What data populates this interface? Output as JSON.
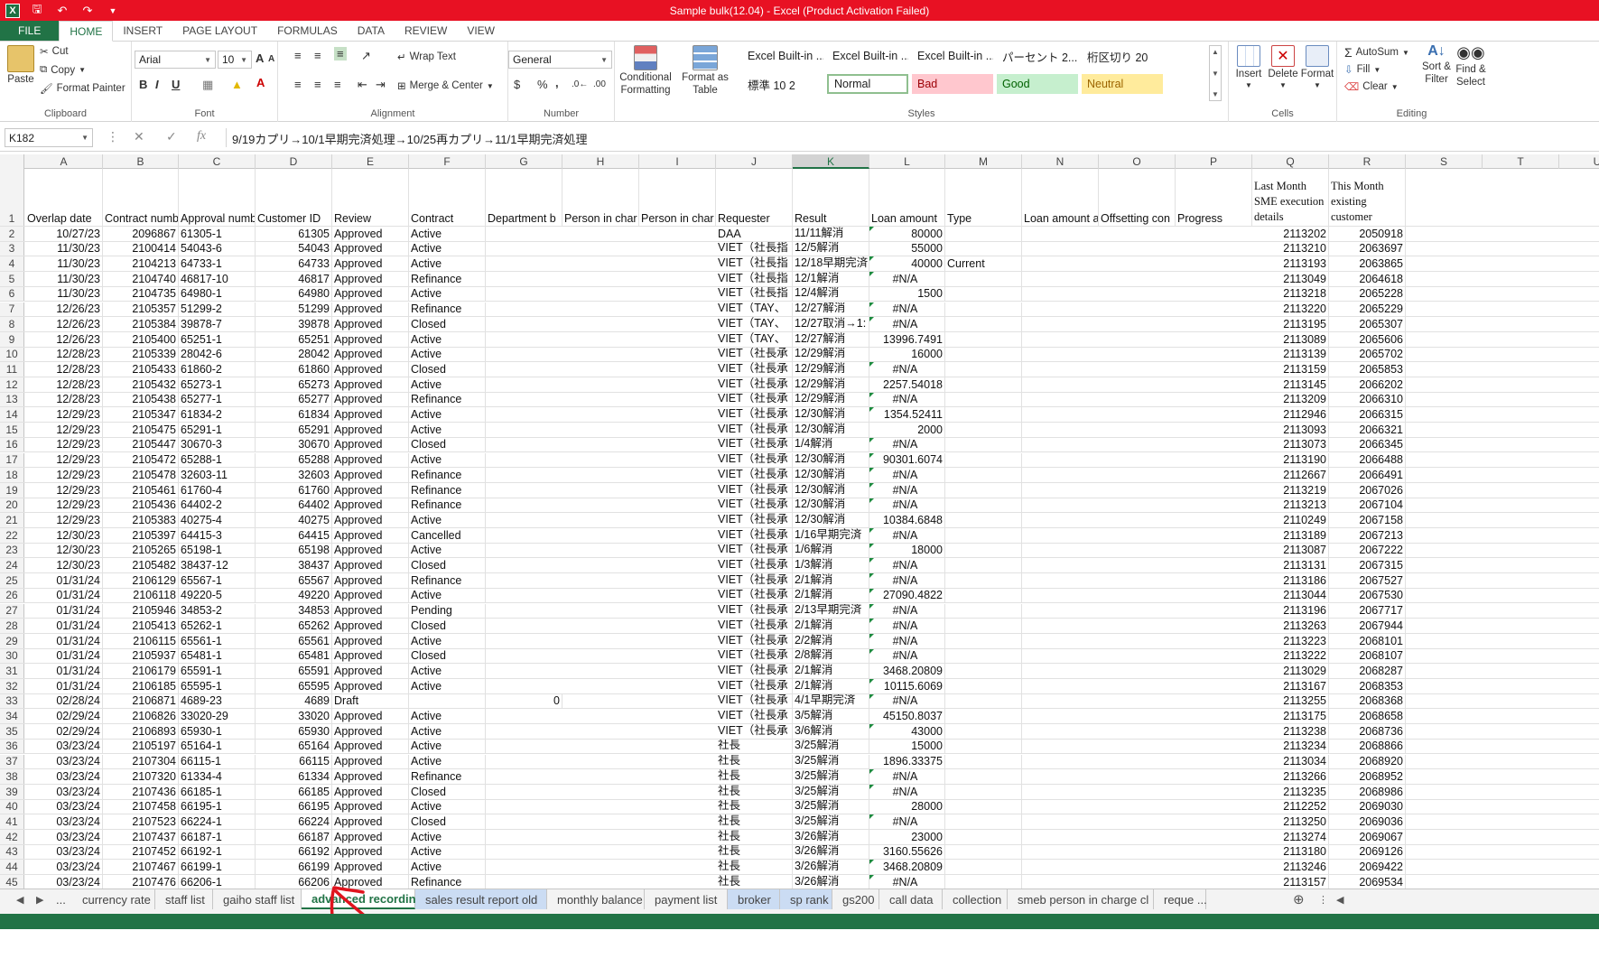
{
  "app": {
    "title": "Sample bulk(12.04) -  Excel (Product Activation Failed)",
    "logo_letter": "X"
  },
  "ribbon_tabs": [
    "FILE",
    "HOME",
    "INSERT",
    "PAGE LAYOUT",
    "FORMULAS",
    "DATA",
    "REVIEW",
    "VIEW"
  ],
  "active_ribbon_tab": "HOME",
  "clipboard": {
    "paste": "Paste",
    "cut": "Cut",
    "copy": "Copy",
    "format_painter": "Format Painter",
    "label": "Clipboard"
  },
  "font": {
    "name": "Arial",
    "size": "10",
    "bold": "B",
    "italic": "I",
    "underline": "U",
    "label": "Font",
    "grow": "A",
    "shrink": "A"
  },
  "alignment": {
    "wrap_text": "Wrap Text",
    "merge_center": "Merge & Center",
    "label": "Alignment"
  },
  "number": {
    "format": "General",
    "currency": "$",
    "percent": "%",
    "comma": ",",
    "label": "Number"
  },
  "styles": {
    "conditional_formatting": "Conditional Formatting",
    "format_as_table": "Format as Table",
    "gallery_top": [
      "Excel Built-in ...",
      "Excel Built-in ...",
      "Excel Built-in ...",
      "パーセント 2...",
      "桁区切り 20"
    ],
    "gallery_bottom": [
      "標準 10 2",
      "Normal",
      "Bad",
      "Good",
      "Neutral"
    ],
    "label": "Styles"
  },
  "cells_group": {
    "insert": "Insert",
    "delete": "Delete",
    "format": "Format",
    "label": "Cells"
  },
  "editing": {
    "autosum": "AutoSum",
    "fill": "Fill",
    "clear": "Clear",
    "sort_filter": "Sort & Filter",
    "find_select": "Find & Select",
    "label": "Editing"
  },
  "formula_bar": {
    "name_box": "K182",
    "fx": "fx",
    "formula": "9/19カプリ→10/1早期完済処理→10/25再カプリ→11/1早期完済処理"
  },
  "columns": [
    "A",
    "B",
    "C",
    "D",
    "E",
    "F",
    "G",
    "H",
    "I",
    "J",
    "K",
    "L",
    "M",
    "N",
    "O",
    "P",
    "Q",
    "R",
    "S",
    "T",
    "U"
  ],
  "selected_column": "K",
  "header_row": {
    "A": "Overlap date",
    "B": "Contract numb",
    "C": "Approval numb",
    "D": "Customer ID",
    "E": "Review",
    "F": "Contract",
    "G": "Department b",
    "H": "Person in char",
    "I": "Person in char",
    "J": "Requester",
    "K": "Result",
    "L": "Loan amount",
    "M": "Type",
    "N": "Loan amount a",
    "O": "Offsetting con",
    "P": "Progress",
    "Q": "Last Month SME execution details",
    "R": "This Month existing customer"
  },
  "rows": [
    {
      "n": "2",
      "A": "10/27/23",
      "B": "2096867",
      "C": "61305-1",
      "D": "61305",
      "E": "Approved",
      "F": "Active",
      "J": "DAA",
      "K": "11/11解消",
      "L": "80000",
      "M": "",
      "Q": "2113202",
      "R": "2050918"
    },
    {
      "n": "3",
      "A": "11/30/23",
      "B": "2100414",
      "C": "54043-6",
      "D": "54043",
      "E": "Approved",
      "F": "Active",
      "J": "VIET（社長指",
      "K": "12/5解消",
      "L": "55000",
      "M": "",
      "Q": "2113210",
      "R": "2063697"
    },
    {
      "n": "4",
      "A": "11/30/23",
      "B": "2104213",
      "C": "64733-1",
      "D": "64733",
      "E": "Approved",
      "F": "Active",
      "J": "VIET（社長指",
      "K": "12/18早期完済",
      "L": "40000",
      "M": "Current",
      "Q": "2113193",
      "R": "2063865"
    },
    {
      "n": "5",
      "A": "11/30/23",
      "B": "2104740",
      "C": "46817-10",
      "D": "46817",
      "E": "Approved",
      "F": "Refinance",
      "J": "VIET（社長指",
      "K": "12/1解消",
      "L": "#N/A",
      "M": "",
      "Q": "2113049",
      "R": "2064618"
    },
    {
      "n": "6",
      "A": "11/30/23",
      "B": "2104735",
      "C": "64980-1",
      "D": "64980",
      "E": "Approved",
      "F": "Active",
      "J": "VIET（社長指",
      "K": "12/4解消",
      "L": "1500",
      "M": "",
      "Q": "2113218",
      "R": "2065228"
    },
    {
      "n": "7",
      "A": "12/26/23",
      "B": "2105357",
      "C": "51299-2",
      "D": "51299",
      "E": "Approved",
      "F": "Refinance",
      "J": "VIET（TAY、",
      "K": "12/27解消",
      "L": "#N/A",
      "M": "",
      "Q": "2113220",
      "R": "2065229"
    },
    {
      "n": "8",
      "A": "12/26/23",
      "B": "2105384",
      "C": "39878-7",
      "D": "39878",
      "E": "Approved",
      "F": "Closed",
      "J": "VIET（TAY、",
      "K": "12/27取消→1:",
      "L": "#N/A",
      "M": "",
      "Q": "2113195",
      "R": "2065307"
    },
    {
      "n": "9",
      "A": "12/26/23",
      "B": "2105400",
      "C": "65251-1",
      "D": "65251",
      "E": "Approved",
      "F": "Active",
      "J": "VIET（TAY、",
      "K": "12/27解消",
      "L": "13996.7491",
      "M": "",
      "Q": "2113089",
      "R": "2065606"
    },
    {
      "n": "10",
      "A": "12/28/23",
      "B": "2105339",
      "C": "28042-6",
      "D": "28042",
      "E": "Approved",
      "F": "Active",
      "J": "VIET（社長承",
      "K": "12/29解消",
      "L": "16000",
      "M": "",
      "Q": "2113139",
      "R": "2065702"
    },
    {
      "n": "11",
      "A": "12/28/23",
      "B": "2105433",
      "C": "61860-2",
      "D": "61860",
      "E": "Approved",
      "F": "Closed",
      "J": "VIET（社長承",
      "K": "12/29解消",
      "L": "#N/A",
      "M": "",
      "Q": "2113159",
      "R": "2065853"
    },
    {
      "n": "12",
      "A": "12/28/23",
      "B": "2105432",
      "C": "65273-1",
      "D": "65273",
      "E": "Approved",
      "F": "Active",
      "J": "VIET（社長承",
      "K": "12/29解消",
      "L": "2257.54018",
      "M": "",
      "Q": "2113145",
      "R": "2066202"
    },
    {
      "n": "13",
      "A": "12/28/23",
      "B": "2105438",
      "C": "65277-1",
      "D": "65277",
      "E": "Approved",
      "F": "Refinance",
      "J": "VIET（社長承",
      "K": "12/29解消",
      "L": "#N/A",
      "M": "",
      "Q": "2113209",
      "R": "2066310"
    },
    {
      "n": "14",
      "A": "12/29/23",
      "B": "2105347",
      "C": "61834-2",
      "D": "61834",
      "E": "Approved",
      "F": "Active",
      "J": "VIET（社長承",
      "K": "12/30解消",
      "L": "1354.52411",
      "M": "",
      "Q": "2112946",
      "R": "2066315"
    },
    {
      "n": "15",
      "A": "12/29/23",
      "B": "2105475",
      "C": "65291-1",
      "D": "65291",
      "E": "Approved",
      "F": "Active",
      "J": "VIET（社長承",
      "K": "12/30解消",
      "L": "2000",
      "M": "",
      "Q": "2113093",
      "R": "2066321"
    },
    {
      "n": "16",
      "A": "12/29/23",
      "B": "2105447",
      "C": "30670-3",
      "D": "30670",
      "E": "Approved",
      "F": "Closed",
      "J": "VIET（社長承",
      "K": "1/4解消",
      "L": "#N/A",
      "M": "",
      "Q": "2113073",
      "R": "2066345"
    },
    {
      "n": "17",
      "A": "12/29/23",
      "B": "2105472",
      "C": "65288-1",
      "D": "65288",
      "E": "Approved",
      "F": "Active",
      "J": "VIET（社長承",
      "K": "12/30解消",
      "L": "90301.6074",
      "M": "",
      "Q": "2113190",
      "R": "2066488"
    },
    {
      "n": "18",
      "A": "12/29/23",
      "B": "2105478",
      "C": "32603-11",
      "D": "32603",
      "E": "Approved",
      "F": "Refinance",
      "J": "VIET（社長承",
      "K": "12/30解消",
      "L": "#N/A",
      "M": "",
      "Q": "2112667",
      "R": "2066491"
    },
    {
      "n": "19",
      "A": "12/29/23",
      "B": "2105461",
      "C": "61760-4",
      "D": "61760",
      "E": "Approved",
      "F": "Refinance",
      "J": "VIET（社長承",
      "K": "12/30解消",
      "L": "#N/A",
      "M": "",
      "Q": "2113219",
      "R": "2067026"
    },
    {
      "n": "20",
      "A": "12/29/23",
      "B": "2105436",
      "C": "64402-2",
      "D": "64402",
      "E": "Approved",
      "F": "Refinance",
      "J": "VIET（社長承",
      "K": "12/30解消",
      "L": "#N/A",
      "M": "",
      "Q": "2113213",
      "R": "2067104"
    },
    {
      "n": "21",
      "A": "12/29/23",
      "B": "2105383",
      "C": "40275-4",
      "D": "40275",
      "E": "Approved",
      "F": "Active",
      "J": "VIET（社長承",
      "K": "12/30解消",
      "L": "10384.6848",
      "M": "",
      "Q": "2110249",
      "R": "2067158"
    },
    {
      "n": "22",
      "A": "12/30/23",
      "B": "2105397",
      "C": "64415-3",
      "D": "64415",
      "E": "Approved",
      "F": "Cancelled",
      "J": "VIET（社長承",
      "K": "1/16早期完済",
      "L": "#N/A",
      "M": "",
      "Q": "2113189",
      "R": "2067213"
    },
    {
      "n": "23",
      "A": "12/30/23",
      "B": "2105265",
      "C": "65198-1",
      "D": "65198",
      "E": "Approved",
      "F": "Active",
      "J": "VIET（社長承",
      "K": "1/6解消",
      "L": "18000",
      "M": "",
      "Q": "2113087",
      "R": "2067222"
    },
    {
      "n": "24",
      "A": "12/30/23",
      "B": "2105482",
      "C": "38437-12",
      "D": "38437",
      "E": "Approved",
      "F": "Closed",
      "J": "VIET（社長承",
      "K": "1/3解消",
      "L": "#N/A",
      "M": "",
      "Q": "2113131",
      "R": "2067315"
    },
    {
      "n": "25",
      "A": "01/31/24",
      "B": "2106129",
      "C": "65567-1",
      "D": "65567",
      "E": "Approved",
      "F": "Refinance",
      "J": "VIET（社長承",
      "K": "2/1解消",
      "L": "#N/A",
      "M": "",
      "Q": "2113186",
      "R": "2067527"
    },
    {
      "n": "26",
      "A": "01/31/24",
      "B": "2106118",
      "C": "49220-5",
      "D": "49220",
      "E": "Approved",
      "F": "Active",
      "J": "VIET（社長承",
      "K": "2/1解消",
      "L": "27090.4822",
      "M": "",
      "Q": "2113044",
      "R": "2067530"
    },
    {
      "n": "27",
      "A": "01/31/24",
      "B": "2105946",
      "C": "34853-2",
      "D": "34853",
      "E": "Approved",
      "F": "Pending",
      "J": "VIET（社長承",
      "K": "2/13早期完済",
      "L": "#N/A",
      "M": "",
      "Q": "2113196",
      "R": "2067717"
    },
    {
      "n": "28",
      "A": "01/31/24",
      "B": "2105413",
      "C": "65262-1",
      "D": "65262",
      "E": "Approved",
      "F": "Closed",
      "J": "VIET（社長承",
      "K": "2/1解消",
      "L": "#N/A",
      "M": "",
      "Q": "2113263",
      "R": "2067944"
    },
    {
      "n": "29",
      "A": "01/31/24",
      "B": "2106115",
      "C": "65561-1",
      "D": "65561",
      "E": "Approved",
      "F": "Active",
      "J": "VIET（社長承",
      "K": "2/2解消",
      "L": "#N/A",
      "M": "",
      "Q": "2113223",
      "R": "2068101"
    },
    {
      "n": "30",
      "A": "01/31/24",
      "B": "2105937",
      "C": "65481-1",
      "D": "65481",
      "E": "Approved",
      "F": "Closed",
      "J": "VIET（社長承",
      "K": "2/8解消",
      "L": "#N/A",
      "M": "",
      "Q": "2113222",
      "R": "2068107"
    },
    {
      "n": "31",
      "A": "01/31/24",
      "B": "2106179",
      "C": "65591-1",
      "D": "65591",
      "E": "Approved",
      "F": "Active",
      "J": "VIET（社長承",
      "K": "2/1解消",
      "L": "3468.20809",
      "M": "",
      "Q": "2113029",
      "R": "2068287"
    },
    {
      "n": "32",
      "A": "01/31/24",
      "B": "2106185",
      "C": "65595-1",
      "D": "65595",
      "E": "Approved",
      "F": "Active",
      "J": "VIET（社長承",
      "K": "2/1解消",
      "L": "10115.6069",
      "M": "",
      "Q": "2113167",
      "R": "2068353"
    },
    {
      "n": "33",
      "A": "02/28/24",
      "B": "2106871",
      "C": "4689-23",
      "D": "4689",
      "E": "Draft",
      "F": "",
      "G": "0",
      "J": "VIET（社長承",
      "K": "4/1早期完済",
      "L": "#N/A",
      "M": "",
      "Q": "2113255",
      "R": "2068368"
    },
    {
      "n": "34",
      "A": "02/29/24",
      "B": "2106826",
      "C": "33020-29",
      "D": "33020",
      "E": "Approved",
      "F": "Active",
      "J": "VIET（社長承",
      "K": "3/5解消",
      "L": "45150.8037",
      "M": "",
      "Q": "2113175",
      "R": "2068658"
    },
    {
      "n": "35",
      "A": "02/29/24",
      "B": "2106893",
      "C": "65930-1",
      "D": "65930",
      "E": "Approved",
      "F": "Active",
      "J": "VIET（社長承",
      "K": "3/6解消",
      "L": "43000",
      "M": "",
      "Q": "2113238",
      "R": "2068736"
    },
    {
      "n": "36",
      "A": "03/23/24",
      "B": "2105197",
      "C": "65164-1",
      "D": "65164",
      "E": "Approved",
      "F": "Active",
      "J": "社長",
      "K": "3/25解消",
      "L": "15000",
      "M": "",
      "Q": "2113234",
      "R": "2068866"
    },
    {
      "n": "37",
      "A": "03/23/24",
      "B": "2107304",
      "C": "66115-1",
      "D": "66115",
      "E": "Approved",
      "F": "Active",
      "J": "社長",
      "K": "3/25解消",
      "L": "1896.33375",
      "M": "",
      "Q": "2113034",
      "R": "2068920"
    },
    {
      "n": "38",
      "A": "03/23/24",
      "B": "2107320",
      "C": "61334-4",
      "D": "61334",
      "E": "Approved",
      "F": "Refinance",
      "J": "社長",
      "K": "3/25解消",
      "L": "#N/A",
      "M": "",
      "Q": "2113266",
      "R": "2068952"
    },
    {
      "n": "39",
      "A": "03/23/24",
      "B": "2107436",
      "C": "66185-1",
      "D": "66185",
      "E": "Approved",
      "F": "Closed",
      "J": "社長",
      "K": "3/25解消",
      "L": "#N/A",
      "M": "",
      "Q": "2113235",
      "R": "2068986"
    },
    {
      "n": "40",
      "A": "03/23/24",
      "B": "2107458",
      "C": "66195-1",
      "D": "66195",
      "E": "Approved",
      "F": "Active",
      "J": "社長",
      "K": "3/25解消",
      "L": "28000",
      "M": "",
      "Q": "2112252",
      "R": "2069030"
    },
    {
      "n": "41",
      "A": "03/23/24",
      "B": "2107523",
      "C": "66224-1",
      "D": "66224",
      "E": "Approved",
      "F": "Closed",
      "J": "社長",
      "K": "3/25解消",
      "L": "#N/A",
      "M": "",
      "Q": "2113250",
      "R": "2069036"
    },
    {
      "n": "42",
      "A": "03/23/24",
      "B": "2107437",
      "C": "66187-1",
      "D": "66187",
      "E": "Approved",
      "F": "Active",
      "J": "社長",
      "K": "3/26解消",
      "L": "23000",
      "M": "",
      "Q": "2113274",
      "R": "2069067"
    },
    {
      "n": "43",
      "A": "03/23/24",
      "B": "2107452",
      "C": "66192-1",
      "D": "66192",
      "E": "Approved",
      "F": "Active",
      "J": "社長",
      "K": "3/26解消",
      "L": "3160.55626",
      "M": "",
      "Q": "2113180",
      "R": "2069126"
    },
    {
      "n": "44",
      "A": "03/23/24",
      "B": "2107467",
      "C": "66199-1",
      "D": "66199",
      "E": "Approved",
      "F": "Active",
      "J": "社長",
      "K": "3/26解消",
      "L": "3468.20809",
      "M": "",
      "Q": "2113246",
      "R": "2069422"
    },
    {
      "n": "45",
      "A": "03/23/24",
      "B": "2107476",
      "C": "66206-1",
      "D": "66206",
      "E": "Approved",
      "F": "Refinance",
      "J": "社長",
      "K": "3/26解消",
      "L": "#N/A",
      "M": "",
      "Q": "2113157",
      "R": "2069534"
    }
  ],
  "sheet_tabs": [
    {
      "name": "...",
      "style": "plain"
    },
    {
      "name": "currency rate",
      "style": "plain"
    },
    {
      "name": "staff list",
      "style": "plain"
    },
    {
      "name": "gaiho staff list",
      "style": "plain"
    },
    {
      "name": "advanced recording",
      "style": "active"
    },
    {
      "name": "sales result report old",
      "style": "colored"
    },
    {
      "name": "monthly balance",
      "style": "plain"
    },
    {
      "name": "payment list",
      "style": "plain"
    },
    {
      "name": "broker",
      "style": "colored"
    },
    {
      "name": "sp rank",
      "style": "colored"
    },
    {
      "name": "gs200",
      "style": "plain"
    },
    {
      "name": "call data",
      "style": "plain"
    },
    {
      "name": "collection",
      "style": "plain"
    },
    {
      "name": "smeb person in charge cl",
      "style": "plain"
    },
    {
      "name": "reque ...",
      "style": "plain"
    }
  ],
  "colors": {
    "excel_green": "#217346",
    "title_red": "#e81123",
    "annotation_red": "#e0141e",
    "tab_blue": "#cbdcf3"
  }
}
